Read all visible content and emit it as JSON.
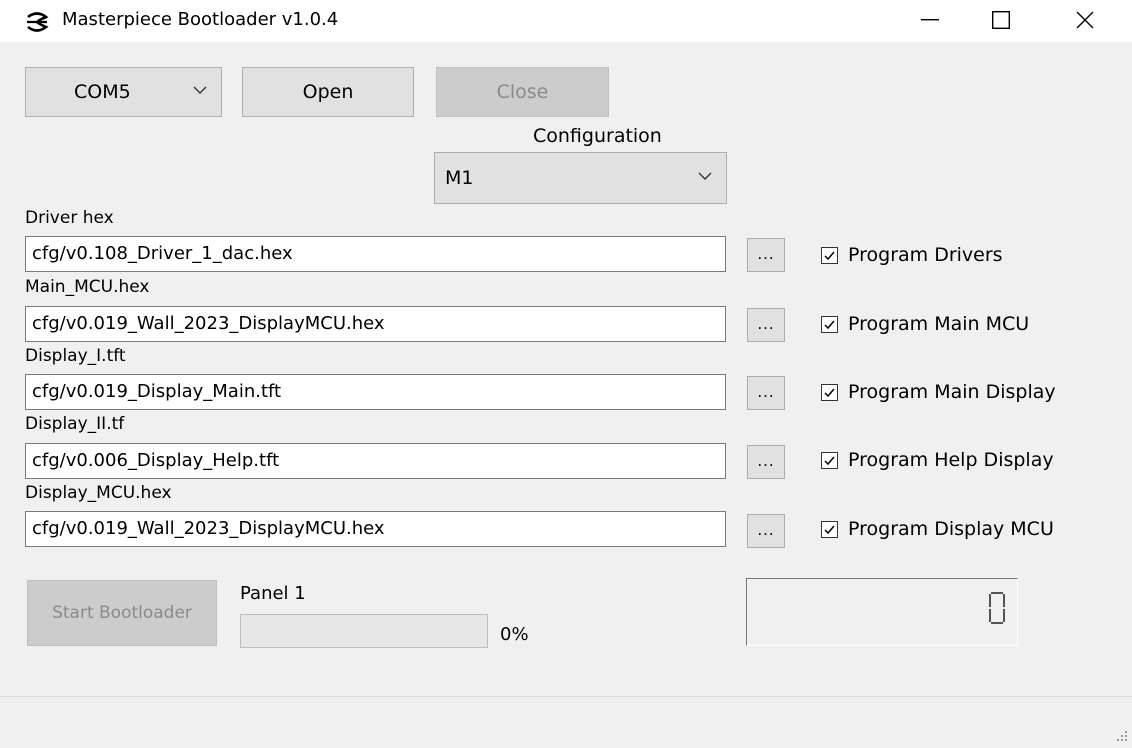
{
  "window": {
    "title": "Masterpiece Bootloader v1.0.4",
    "controls": {
      "minimize_icon": "minimize-icon",
      "maximize_icon": "maximize-icon",
      "close_icon": "close-icon"
    }
  },
  "connection": {
    "port_value": "COM5",
    "open_label": "Open",
    "close_label": "Close"
  },
  "configuration": {
    "label": "Configuration",
    "value": "M1"
  },
  "files": [
    {
      "label": "Driver hex",
      "value": "cfg/v0.108_Driver_1_dac.hex",
      "browse": "...",
      "check_label": "Program Drivers",
      "checked": true
    },
    {
      "label": "Main_MCU.hex",
      "value": "cfg/v0.019_Wall_2023_DisplayMCU.hex",
      "browse": "...",
      "check_label": "Program Main MCU",
      "checked": true
    },
    {
      "label": "Display_I.tft",
      "value": "cfg/v0.019_Display_Main.tft",
      "browse": "...",
      "check_label": "Program Main Display",
      "checked": true
    },
    {
      "label": "Display_II.tf",
      "value": "cfg/v0.006_Display_Help.tft",
      "browse": "...",
      "check_label": "Program Help Display",
      "checked": true
    },
    {
      "label": "Display_MCU.hex",
      "value": "cfg/v0.019_Wall_2023_DisplayMCU.hex",
      "browse": "...",
      "check_label": "Program Display MCU",
      "checked": true
    }
  ],
  "bootloader": {
    "start_label": "Start Bootloader",
    "panel_label": "Panel 1",
    "progress": 0,
    "progress_text": "0%",
    "counter": "0"
  },
  "colors": {
    "window_bg": "#f0f0f0",
    "button_bg": "#e1e1e1",
    "disabled_bg": "#cccccc",
    "disabled_text": "#8a8a8a"
  }
}
